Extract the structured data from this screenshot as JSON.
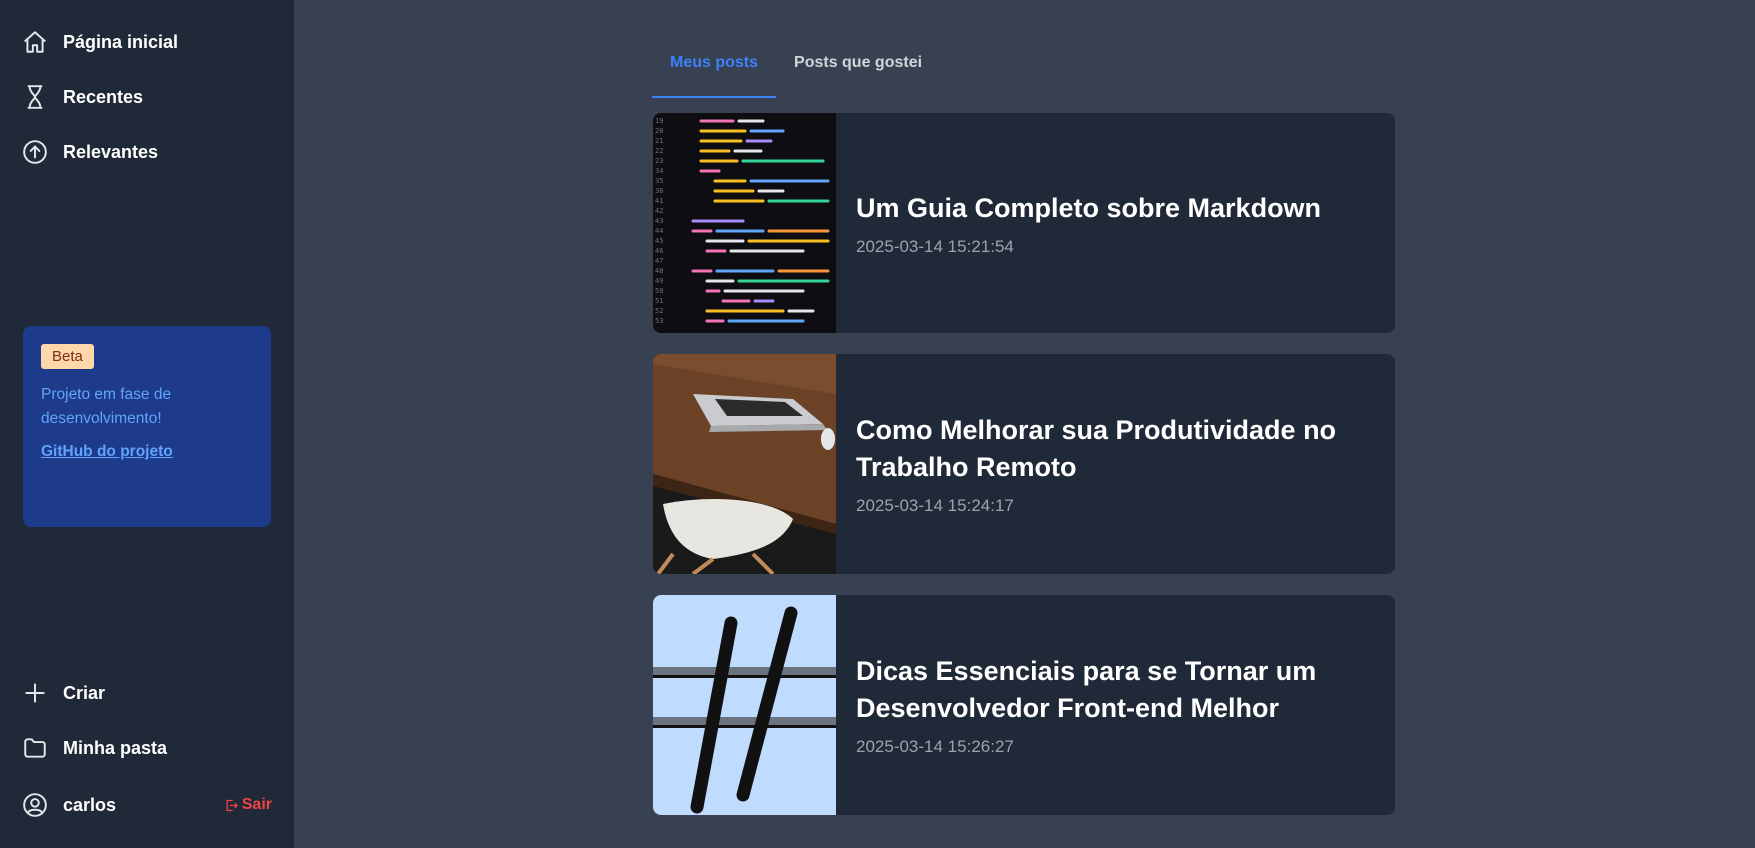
{
  "sidebar": {
    "nav": [
      {
        "label": "Página inicial",
        "icon": "home-icon"
      },
      {
        "label": "Recentes",
        "icon": "hourglass-icon"
      },
      {
        "label": "Relevantes",
        "icon": "arrow-up-circle-icon"
      }
    ],
    "beta": {
      "badge": "Beta",
      "text": "Projeto em fase de desenvolvimento!",
      "link": "GitHub do projeto"
    },
    "bottom": [
      {
        "label": "Criar",
        "icon": "plus-icon"
      },
      {
        "label": "Minha pasta",
        "icon": "folder-icon"
      }
    ],
    "user": {
      "name": "carlos",
      "icon": "user-circle-icon",
      "logout_label": "Sair",
      "logout_icon": "logout-icon"
    }
  },
  "tabs": [
    {
      "label": "Meus posts",
      "active": true
    },
    {
      "label": "Posts que gostei",
      "active": false
    }
  ],
  "posts": [
    {
      "title": "Um Guia Completo sobre Markdown",
      "date": "2025-03-14 15:21:54",
      "thumb": "code-screen-image"
    },
    {
      "title": "Como Melhorar sua Produtividade no Trabalho Remoto",
      "date": "2025-03-14 15:24:17",
      "thumb": "laptop-desk-image"
    },
    {
      "title": "Dicas Essenciais para se Tornar um Desenvolvedor Front-end Melhor",
      "date": "2025-03-14 15:26:27",
      "thumb": "hashtag-image"
    }
  ],
  "colors": {
    "sidebar_bg": "#1f2937",
    "main_bg": "#374151",
    "card_bg": "#1f2937",
    "accent": "#3b82f6",
    "beta_bg": "#1e3a8a",
    "danger": "#ef4444"
  }
}
